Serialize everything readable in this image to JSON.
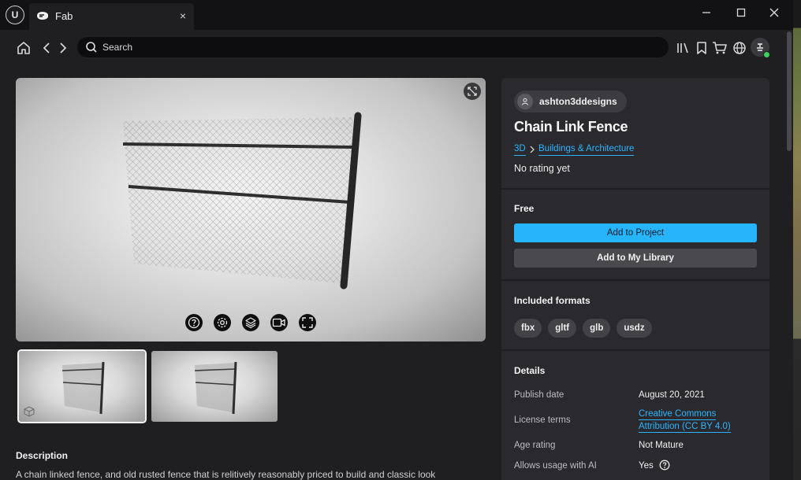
{
  "window": {
    "tab_label": "Fab",
    "tab_close": "×",
    "app_logo": "U"
  },
  "nav": {
    "search_placeholder": "Search"
  },
  "viewer": {
    "tools": [
      "help-icon",
      "settings-icon",
      "layers-icon",
      "camera-icon",
      "fullscreen-icon"
    ]
  },
  "description": {
    "title": "Description",
    "text": "A chain linked fence, and old rusted fence that is relitively reasonably priced to build and classic look"
  },
  "asset": {
    "author": "ashton3ddesigns",
    "title": "Chain Link Fence",
    "breadcrumb": [
      "3D",
      "Buildings & Architecture"
    ],
    "rating": "No rating yet"
  },
  "pricing": {
    "price": "Free",
    "add_to_project": "Add to Project",
    "add_to_library": "Add to My Library"
  },
  "formats": {
    "title": "Included formats",
    "items": [
      "fbx",
      "gltf",
      "glb",
      "usdz"
    ]
  },
  "details": {
    "title": "Details",
    "publish_date_label": "Publish date",
    "publish_date": "August 20, 2021",
    "license_label": "License terms",
    "license_line1": "Creative Commons",
    "license_line2": "Attribution (CC BY 4.0)",
    "age_label": "Age rating",
    "age_value": "Not Mature",
    "ai_label": "Allows usage with AI",
    "ai_value": "Yes"
  },
  "colors": {
    "accent": "#26b4fb",
    "link": "#2eb4ff",
    "panel": "#2a2a2e",
    "background": "#1f1f22"
  }
}
